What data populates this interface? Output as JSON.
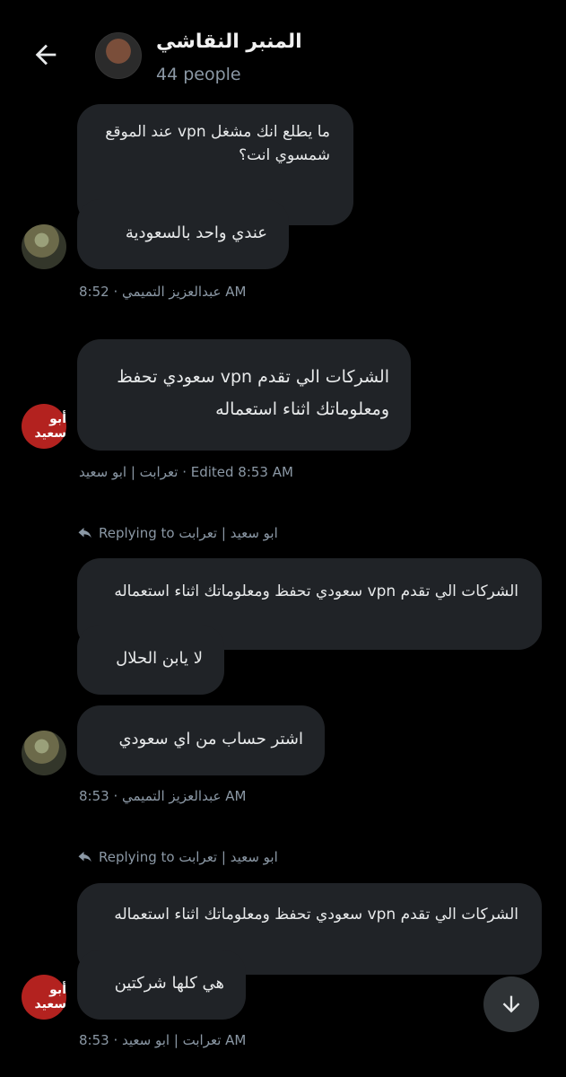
{
  "header": {
    "title": "المنبر النقاشي",
    "subtitle": "44 people"
  },
  "messages": [
    {
      "quote": "ما يطلع انك مشغل vpn عند الموقع شمسوي انت؟",
      "text": "عندي واحد بالسعودية",
      "meta": "عبدالعزيز التميمي · 8:52 AM"
    },
    {
      "text": "الشركات الي تقدم vpn سعودي تحفظ ومعلوماتك اثناء استعماله",
      "meta": "تعرابت | ابو سعيد · Edited 8:53 AM"
    },
    {
      "reply_label": "Replying to ابو سعيد | تعرابت",
      "quote": "الشركات الي تقدم vpn سعودي تحفظ ومعلوماتك اثناء استعماله",
      "text1": "لا يابن الحلال",
      "text2": "اشتر حساب من اي سعودي",
      "meta": "عبدالعزيز التميمي · 8:53 AM"
    },
    {
      "reply_label": "Replying to ابو سعيد | تعرابت",
      "quote": "الشركات الي تقدم vpn سعودي تحفظ ومعلوماتك اثناء استعماله",
      "text": "هي كلها شركتين",
      "meta": "تعرابت | ابو سعيد · 8:53 AM"
    }
  ],
  "avatar_b_text": "أبو سعيد",
  "icons": {
    "back": "back-arrow-icon",
    "reply": "reply-arrow-icon",
    "scroll": "scroll-down-icon"
  },
  "colors": {
    "background": "#000000",
    "bubble": "#202327",
    "meta": "#8b98a5",
    "avatar_b": "#b3221f"
  }
}
